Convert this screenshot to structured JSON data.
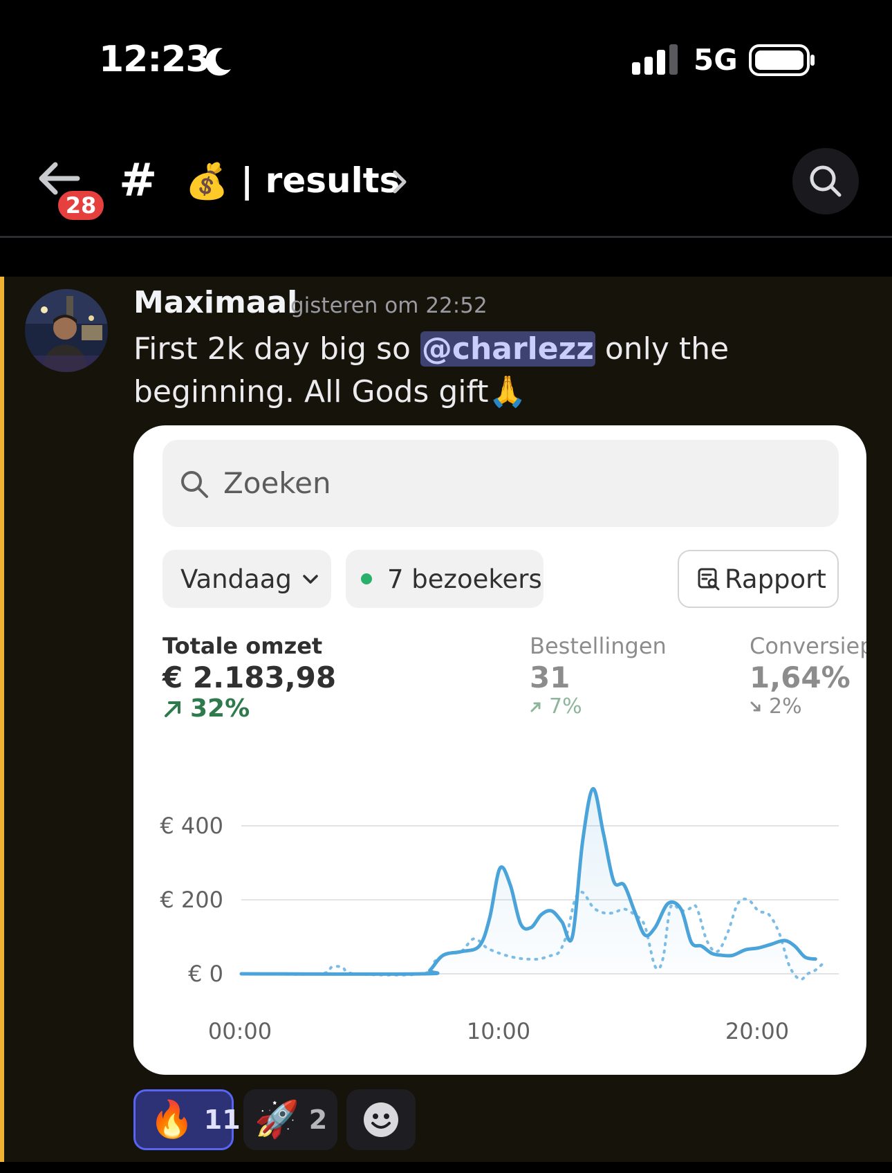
{
  "status_bar": {
    "time": "12:23",
    "network": "5G"
  },
  "header": {
    "back_badge": "28",
    "channel_prefix": "#",
    "channel_emoji": "💰",
    "channel_name": "| results"
  },
  "message": {
    "author": "Maximaal",
    "timestamp": "gisteren om 22:52",
    "text_before": "First 2k day big so ",
    "mention": "@charlezz",
    "text_after": " only the beginning. All Gods gift🙏"
  },
  "embed": {
    "search_placeholder": "Zoeken",
    "date_filter": "Vandaag",
    "visitors": "7 bezoekers",
    "report_button": "Rapport",
    "metrics": [
      {
        "label": "Totale omzet",
        "value": "€ 2.183,98",
        "delta": "32%",
        "direction": "up"
      },
      {
        "label": "Bestellingen",
        "value": "31",
        "delta": "7%",
        "direction": "up"
      },
      {
        "label": "Conversiep",
        "value": "1,64%",
        "delta": "2%",
        "direction": "down"
      }
    ],
    "colors": {
      "line": "#4aa3d9",
      "positive": "#2f7a4c"
    }
  },
  "chart_data": {
    "type": "line",
    "y_ticks": [
      "€ 400",
      "€ 200",
      "€ 0"
    ],
    "x_ticks": [
      "00:00",
      "10:00",
      "20:00"
    ],
    "ylim": [
      0,
      500
    ],
    "grid": true,
    "series": [
      {
        "style": "solid",
        "x": [
          0,
          7,
          7.3,
          7.8,
          8.5,
          9.2,
          9.6,
          10,
          10.4,
          10.8,
          11.2,
          11.6,
          12,
          12.4,
          12.8,
          13.2,
          13.6,
          14,
          14.4,
          14.8,
          15.2,
          15.6,
          16,
          16.5,
          17,
          17.4,
          17.8,
          18.2,
          18.6,
          19,
          19.5,
          20,
          20.5,
          21,
          21.4,
          21.8,
          22.2
        ],
        "y": [
          0,
          0,
          10,
          50,
          60,
          75,
          150,
          285,
          240,
          135,
          125,
          160,
          170,
          140,
          100,
          360,
          500,
          380,
          250,
          240,
          170,
          105,
          125,
          190,
          175,
          85,
          75,
          55,
          50,
          50,
          65,
          70,
          80,
          90,
          75,
          45,
          40
        ]
      },
      {
        "style": "dotted",
        "x": [
          0,
          3,
          3.5,
          3.9,
          4.4,
          7,
          7.5,
          8,
          8.5,
          9,
          9.5,
          10,
          10.5,
          11,
          11.5,
          12,
          12.3,
          12.6,
          12.9,
          13.2,
          13.6,
          14,
          14.4,
          14.8,
          15.2,
          15.6,
          16,
          16.3,
          16.6,
          17,
          17.3,
          17.6,
          18,
          18.4,
          18.8,
          19.2,
          19.6,
          20,
          20.4,
          20.8,
          21.2,
          21.6,
          21.9,
          22.2,
          22.6
        ]
      }
    ]
  }
}
